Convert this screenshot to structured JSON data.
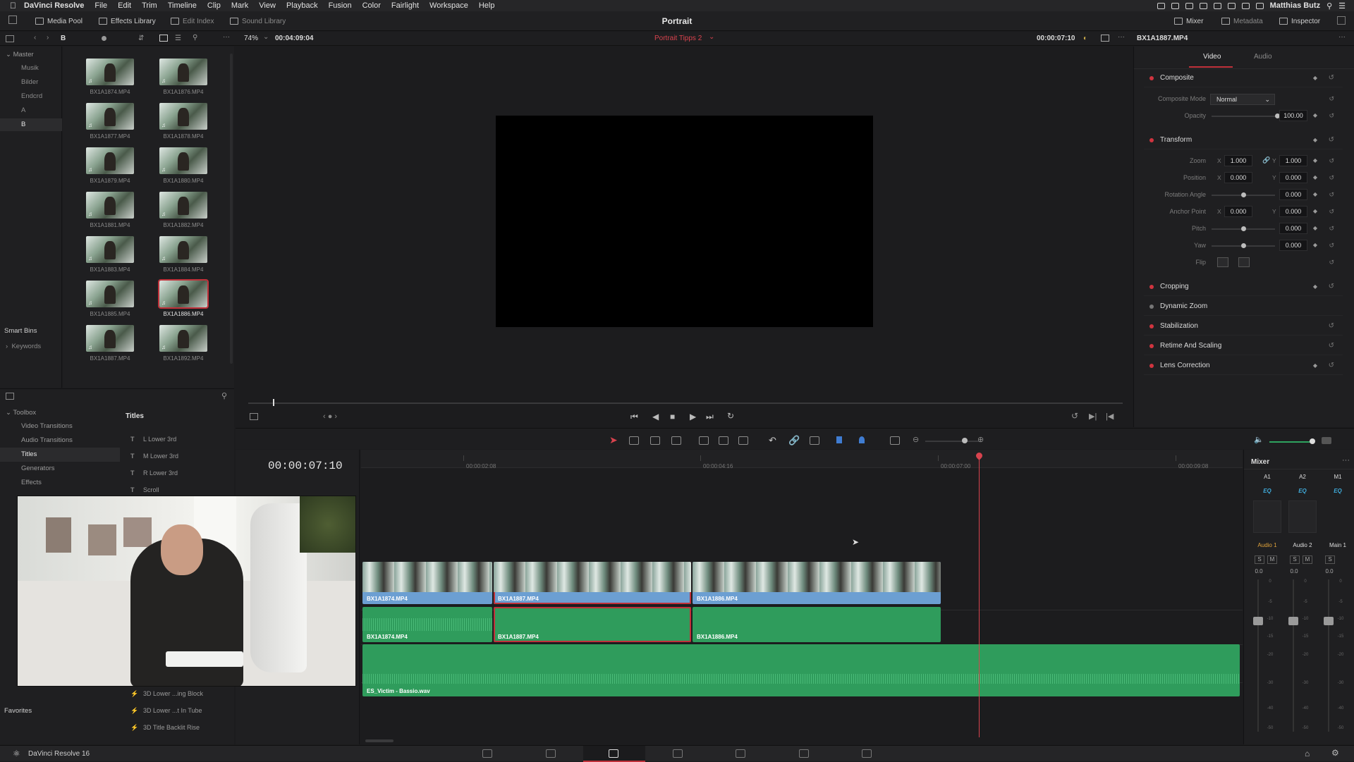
{
  "menubar": {
    "app": "DaVinci Resolve",
    "items": [
      "File",
      "Edit",
      "Trim",
      "Timeline",
      "Clip",
      "Mark",
      "View",
      "Playback",
      "Fusion",
      "Color",
      "Fairlight",
      "Workspace",
      "Help"
    ],
    "user": "Matthias Butz"
  },
  "toolbar": {
    "media_pool": "Media Pool",
    "effects_library": "Effects Library",
    "edit_index": "Edit Index",
    "sound_library": "Sound Library",
    "project_title": "Portrait",
    "mixer": "Mixer",
    "metadata": "Metadata",
    "inspector": "Inspector"
  },
  "secbar": {
    "bin_name": "B",
    "zoom": "74%",
    "source_tc": "00:04:09:04",
    "timeline_name": "Portrait Tipps 2",
    "record_tc": "00:00:07:10",
    "clip_name": "BX1A1887.MP4"
  },
  "bins": {
    "master": "Master",
    "items": [
      "Musik",
      "Bilder",
      "Endcrd",
      "A",
      "B"
    ],
    "smart_bins": "Smart Bins",
    "keywords": "Keywords"
  },
  "clips": [
    {
      "label": "BX1A1874.MP4",
      "selected": false
    },
    {
      "label": "BX1A1876.MP4",
      "selected": false
    },
    {
      "label": "BX1A1877.MP4",
      "selected": false
    },
    {
      "label": "BX1A1878.MP4",
      "selected": false
    },
    {
      "label": "BX1A1879.MP4",
      "selected": false
    },
    {
      "label": "BX1A1880.MP4",
      "selected": false
    },
    {
      "label": "BX1A1881.MP4",
      "selected": false
    },
    {
      "label": "BX1A1882.MP4",
      "selected": false
    },
    {
      "label": "BX1A1883.MP4",
      "selected": false
    },
    {
      "label": "BX1A1884.MP4",
      "selected": false
    },
    {
      "label": "BX1A1885.MP4",
      "selected": false
    },
    {
      "label": "BX1A1886.MP4",
      "selected": true
    },
    {
      "label": "BX1A1887.MP4",
      "selected": false
    },
    {
      "label": "BX1A1892.MP4",
      "selected": false
    }
  ],
  "toolbox": {
    "title": "Toolbox",
    "items": [
      "Video Transitions",
      "Audio Transitions",
      "Titles",
      "Generators",
      "Effects"
    ],
    "selected": "Titles",
    "list_header": "Titles",
    "titles": [
      "L Lower 3rd",
      "M Lower 3rd",
      "R Lower 3rd",
      "Scroll"
    ],
    "fusion_titles": [
      "3D Lower ...ing Block",
      "3D Lower ...t In Tube",
      "3D Title Backlit Rise"
    ],
    "favorites": "Favorites"
  },
  "inspector": {
    "tabs": [
      "Video",
      "Audio"
    ],
    "active_tab": "Video",
    "composite": {
      "title": "Composite",
      "mode_label": "Composite Mode",
      "mode_value": "Normal",
      "opacity_label": "Opacity",
      "opacity_value": "100.00"
    },
    "transform": {
      "title": "Transform",
      "zoom_label": "Zoom",
      "zoom_x": "1.000",
      "zoom_y": "1.000",
      "position_label": "Position",
      "position_x": "0.000",
      "position_y": "0.000",
      "rotation_label": "Rotation Angle",
      "rotation_value": "0.000",
      "anchor_label": "Anchor Point",
      "anchor_x": "0.000",
      "anchor_y": "0.000",
      "pitch_label": "Pitch",
      "pitch_value": "0.000",
      "yaw_label": "Yaw",
      "yaw_value": "0.000",
      "flip_label": "Flip",
      "x_axis": "X",
      "y_axis": "Y"
    },
    "sections": [
      "Cropping",
      "Dynamic Zoom",
      "Stabilization",
      "Retime And Scaling",
      "Lens Correction"
    ]
  },
  "timeline": {
    "timecode": "00:00:07:10",
    "ruler": [
      "00:00:02:08",
      "00:00:04:16",
      "00:00:07:00",
      "00:00:09:08"
    ],
    "video_clips": [
      "BX1A1874.MP4",
      "BX1A1887.MP4",
      "BX1A1886.MP4"
    ],
    "audio_clips": [
      "BX1A1874.MP4",
      "BX1A1887.MP4",
      "BX1A1886.MP4"
    ],
    "music_clip": "ES_Victim - Bassio.wav"
  },
  "mixer": {
    "title": "Mixer",
    "channels": [
      "A1",
      "A2",
      "M1"
    ],
    "eq": "EQ",
    "names": [
      "Audio 1",
      "Audio 2",
      "Main 1"
    ],
    "s": "S",
    "m": "M",
    "db": "0.0",
    "scale": [
      "0",
      "-5",
      "-10",
      "-15",
      "-20",
      "-30",
      "-40",
      "-50"
    ]
  },
  "footer": {
    "app_version": "DaVinci Resolve 16"
  },
  "colors": {
    "accent_red": "#c0313a",
    "video_clip": "#6c9fd2",
    "audio_clip": "#2f9c5c"
  }
}
